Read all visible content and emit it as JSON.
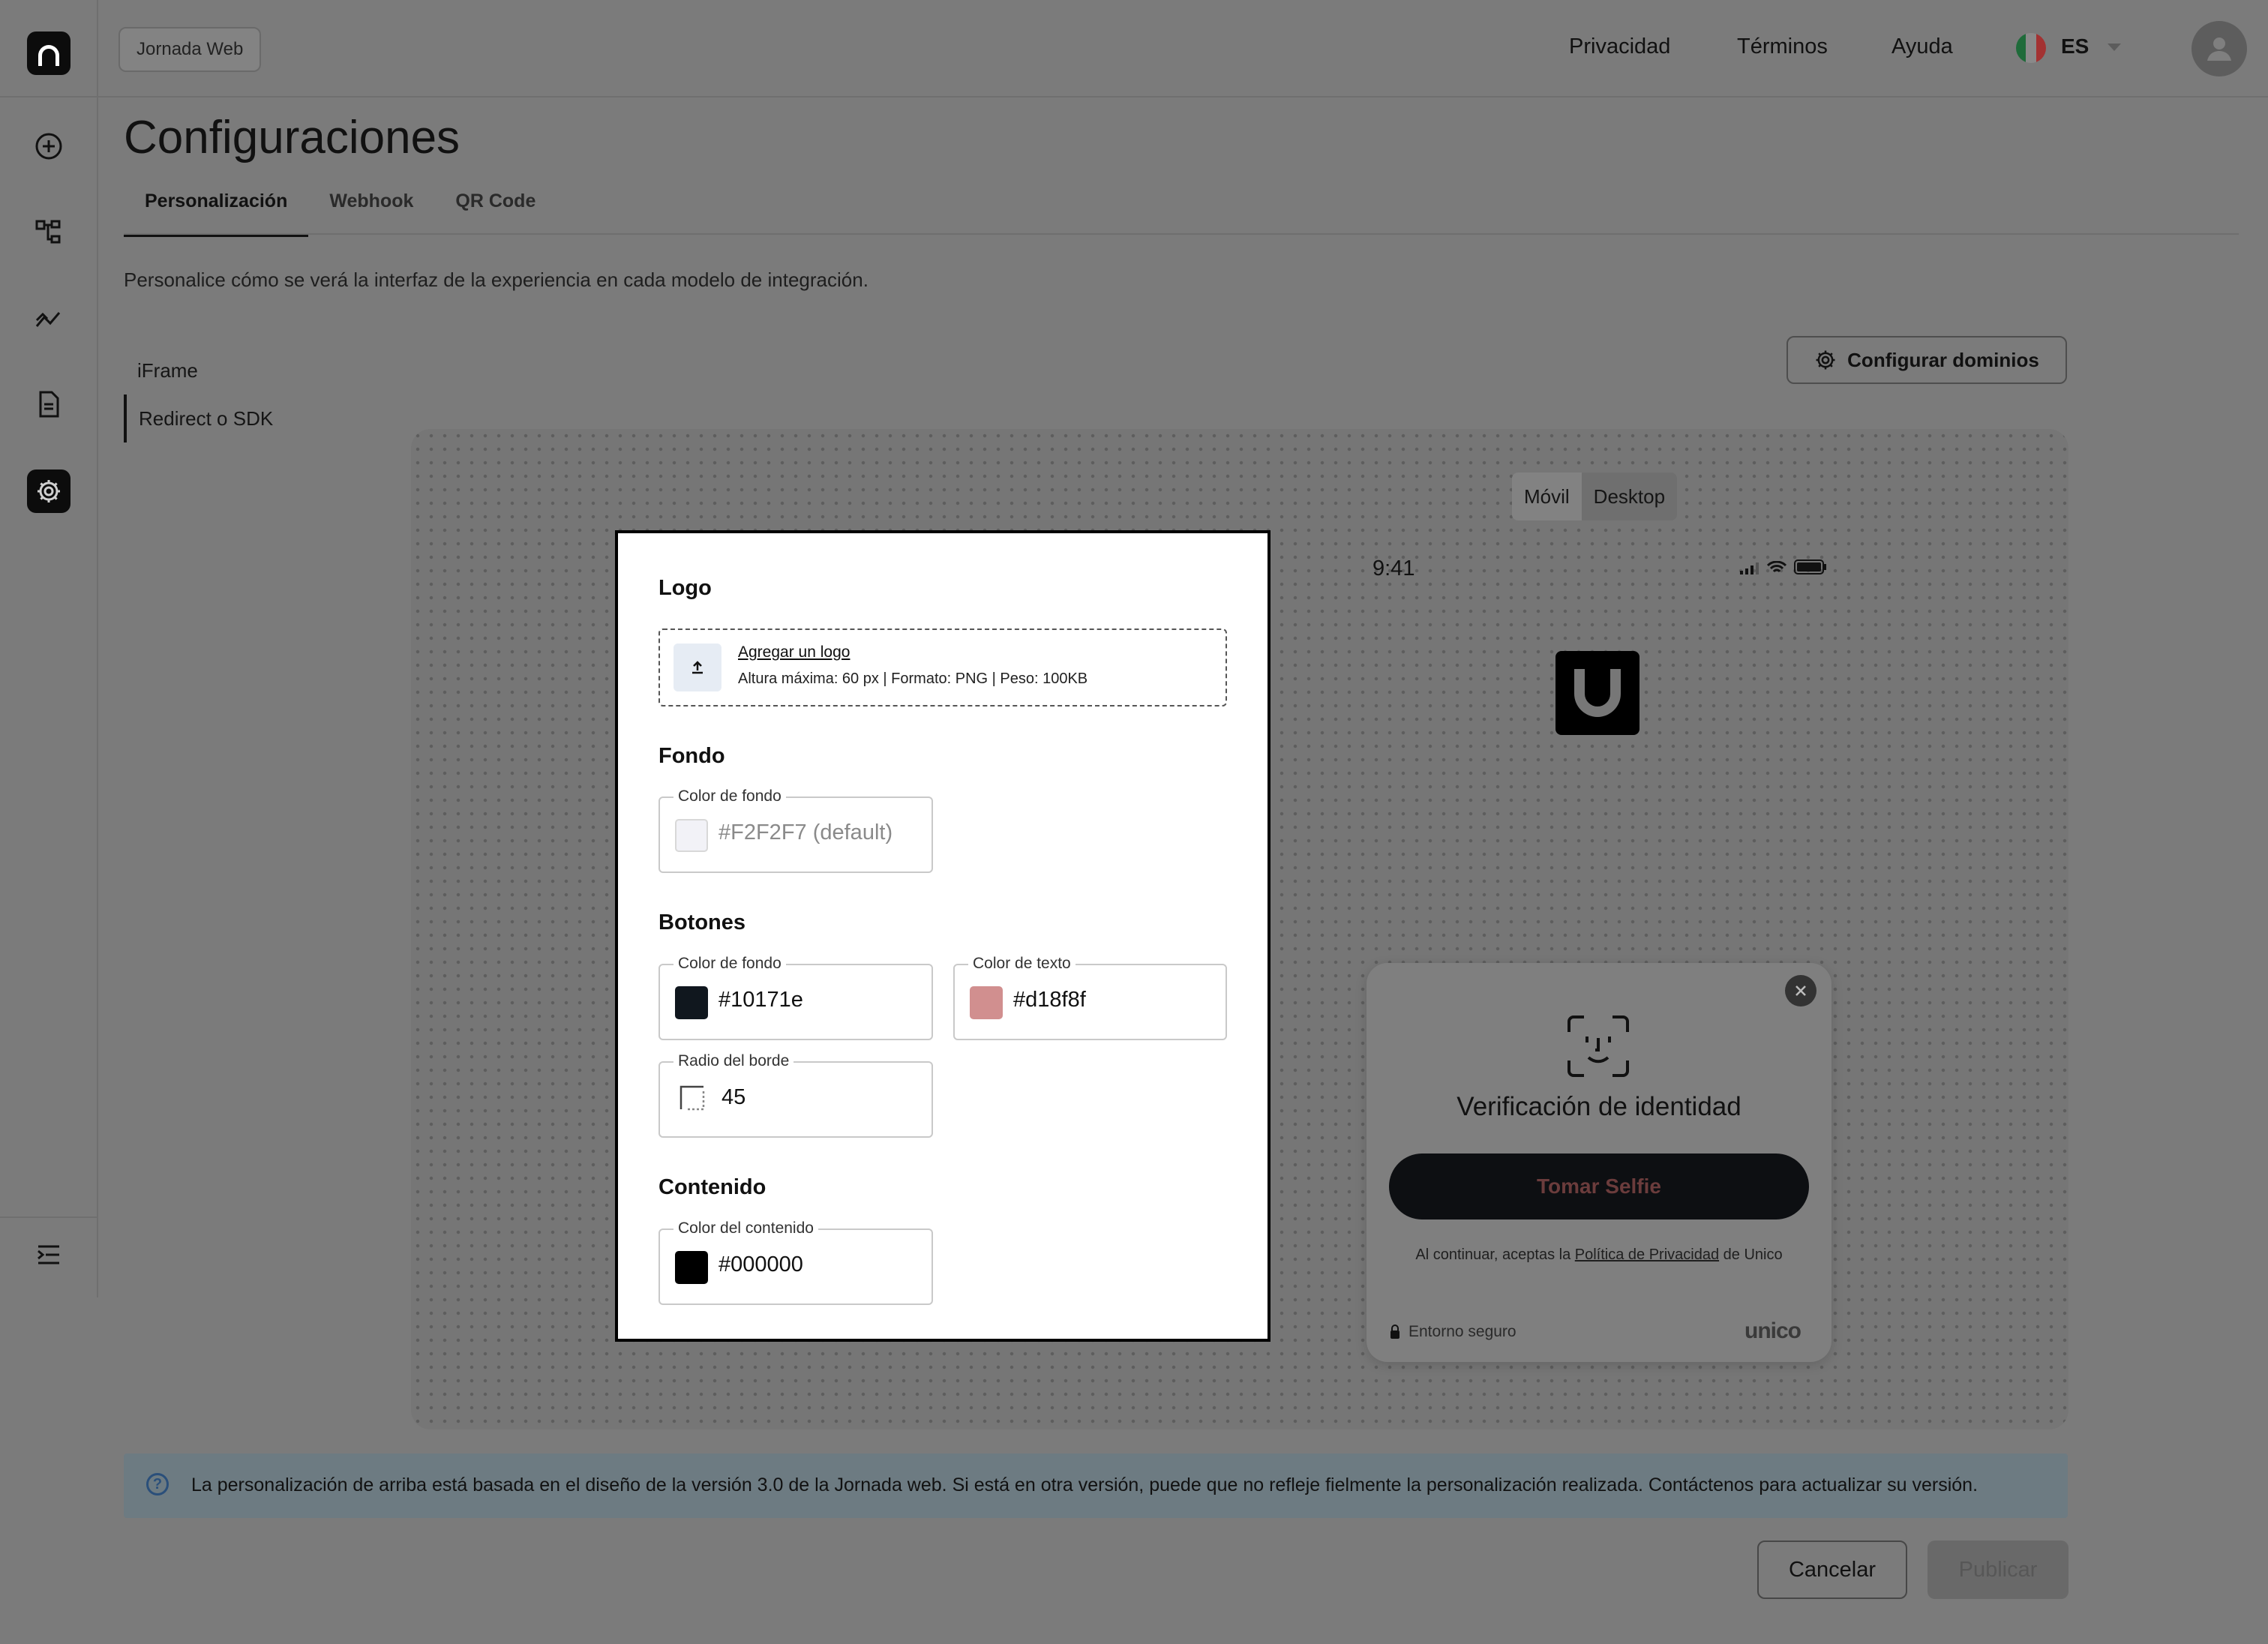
{
  "header": {
    "app_chip": "Jornada Web",
    "nav": [
      "Privacidad",
      "Términos",
      "Ayuda"
    ],
    "language": "ES"
  },
  "page": {
    "title": "Configuraciones",
    "tabs": [
      "Personalización",
      "Webhook",
      "QR Code"
    ],
    "description": "Personalice cómo se verá la interfaz de la experiencia en cada modelo de integración.",
    "subnav": [
      "iFrame",
      "Redirect o SDK"
    ],
    "configure_domains": "Configurar dominios"
  },
  "preview": {
    "device_toggle": [
      "Móvil",
      "Desktop"
    ],
    "time": "9:41",
    "card": {
      "title": "Verificación de identidad",
      "button": "Tomar Selfie",
      "terms_prefix": "Al continuar, aceptas la ",
      "terms_link": "Política de Privacidad",
      "terms_suffix": " de Unico",
      "secure": "Entorno seguro",
      "brand": "unico"
    }
  },
  "panel": {
    "logo": {
      "title": "Logo",
      "link": "Agregar un logo",
      "hint": "Altura máxima: 60 px | Formato: PNG | Peso: 100KB"
    },
    "background": {
      "title": "Fondo",
      "label": "Color de fondo",
      "value": "#F2F2F7 (default)",
      "swatch": "#F2F2F7"
    },
    "buttons": {
      "title": "Botones",
      "bg_label": "Color de fondo",
      "bg_value": "#10171e",
      "text_label": "Color de texto",
      "text_value": "#d18f8f",
      "radius_label": "Radio del borde",
      "radius_value": "45"
    },
    "content": {
      "title": "Contenido",
      "label": "Color del contenido",
      "value": "#000000"
    }
  },
  "info": {
    "text": "La personalización de arriba está basada en el diseño de la versión 3.0 de la Jornada web. Si está en otra versión, puede que no refleje fielmente la personalización realizada. Contáctenos para actualizar su versión."
  },
  "actions": {
    "cancel": "Cancelar",
    "publish": "Publicar"
  }
}
